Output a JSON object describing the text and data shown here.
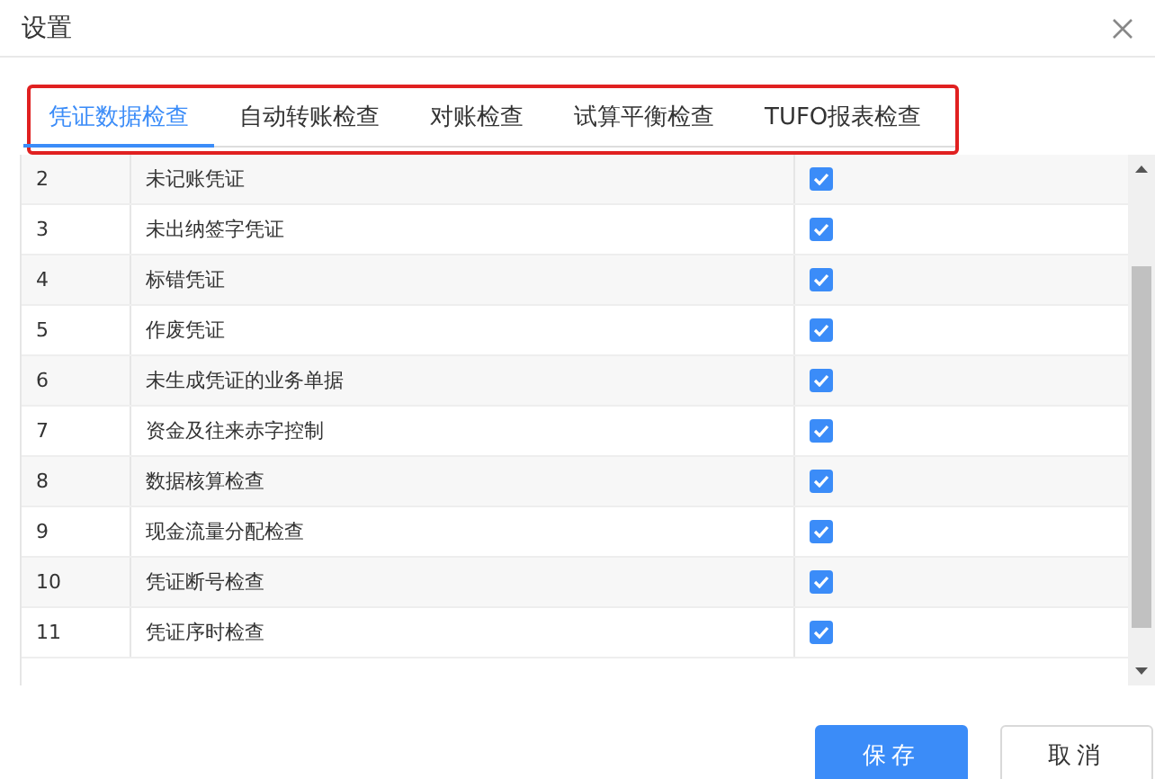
{
  "dialog": {
    "title": "设置"
  },
  "tabs": [
    {
      "label": "凭证数据检查",
      "selected": true
    },
    {
      "label": "自动转账检查",
      "selected": false
    },
    {
      "label": "对账检查",
      "selected": false
    },
    {
      "label": "试算平衡检查",
      "selected": false
    },
    {
      "label": "TUFO报表检查",
      "selected": false
    }
  ],
  "rows": [
    {
      "number": "2",
      "name": "未记账凭证",
      "checked": true
    },
    {
      "number": "3",
      "name": "未出纳签字凭证",
      "checked": true
    },
    {
      "number": "4",
      "name": "标错凭证",
      "checked": true
    },
    {
      "number": "5",
      "name": "作废凭证",
      "checked": true
    },
    {
      "number": "6",
      "name": "未生成凭证的业务单据",
      "checked": true
    },
    {
      "number": "7",
      "name": "资金及往来赤字控制",
      "checked": true
    },
    {
      "number": "8",
      "name": "数据核算检查",
      "checked": true
    },
    {
      "number": "9",
      "name": "现金流量分配检查",
      "checked": true
    },
    {
      "number": "10",
      "name": "凭证断号检查",
      "checked": true
    },
    {
      "number": "11",
      "name": "凭证序时检查",
      "checked": true
    }
  ],
  "buttons": [
    {
      "label": "保存",
      "kind": "primary"
    },
    {
      "label": "取消",
      "kind": "secondary"
    }
  ]
}
